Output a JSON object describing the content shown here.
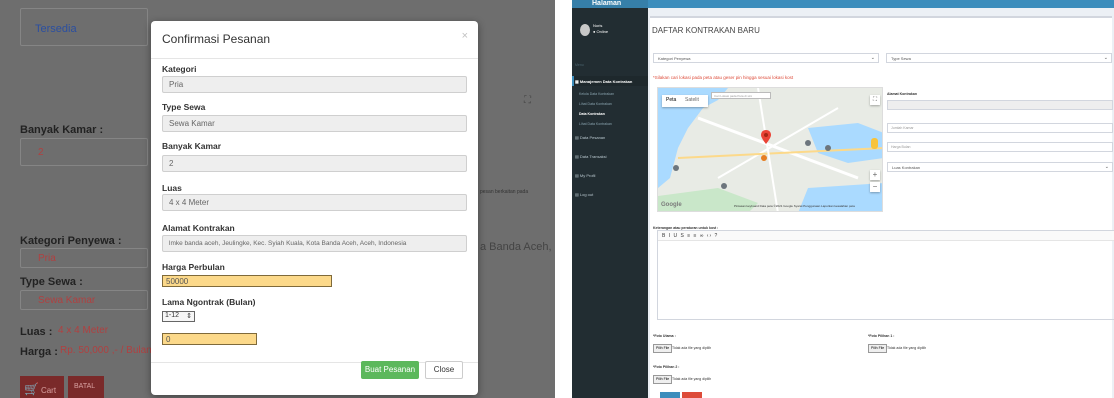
{
  "left": {
    "background": {
      "status_value": "Tersedia",
      "banyak_kamar_label": "Banyak Kamar :",
      "banyak_kamar_value": "2",
      "kategori_label": "Kategori Penyewa :",
      "kategori_value": "Pria",
      "type_sewa_label": "Type Sewa :",
      "type_sewa_value": "Sewa Kamar",
      "luas_label": "Luas :",
      "luas_value": "4 x 4 Meter",
      "harga_label": "Harga :",
      "harga_value": "Rp. 50,000 ,- / Bulan",
      "address_partial": "a Banda Aceh,",
      "side_caption": "pesan berkaitan pada",
      "cart_button": "Cart",
      "cancel_button": "BATAL",
      "expand_icon_glyph": "⛶"
    },
    "modal": {
      "title": "Confirmasi Pesanan",
      "close_glyph": "×",
      "fields": {
        "kategori": {
          "label": "Kategori",
          "value": "Pria"
        },
        "type_sewa": {
          "label": "Type Sewa",
          "value": "Sewa Kamar"
        },
        "banyak_kamar": {
          "label": "Banyak Kamar",
          "value": "2"
        },
        "luas": {
          "label": "Luas",
          "value": "4 x 4 Meter"
        },
        "alamat": {
          "label": "Alamat Kontrakan",
          "value": "lmke banda aceh, Jeulingke, Kec. Syiah Kuala, Kota Banda Aceh, Aceh, Indonesia"
        },
        "harga": {
          "label": "Harga Perbulan",
          "value": "50000"
        },
        "lama": {
          "label": "Lama Ngontrak (Bulan)",
          "value": "1-12"
        },
        "total": {
          "value": "0"
        }
      },
      "buat_button": "Buat Pesanan",
      "close_button": "Close"
    }
  },
  "right": {
    "brand": "Halaman",
    "user": {
      "name": "Noris",
      "status": "● Online"
    },
    "sidebar": {
      "header": "Menu",
      "items": [
        {
          "label": "Manajemen Data Kontrakan",
          "bold": true
        },
        {
          "label": "Kelola Data Kontrakan",
          "sub": true
        },
        {
          "label": "Lihat Data Kontrakan",
          "sub": true
        },
        {
          "label": "Data Kontrakan",
          "sub": true,
          "bold": true
        },
        {
          "label": "Lihat Data Kontrakan",
          "sub": true
        },
        {
          "label": "Data Pesanan"
        },
        {
          "label": "Data Transaksi"
        },
        {
          "label": "My Profil"
        },
        {
          "label": "Log out"
        }
      ]
    },
    "page_title": "DAFTAR KONTRAKAN BARU",
    "kategori_select": "Kategori Penyewa",
    "type_select": "Type Sewa",
    "note": "*Silakan cari lokasi pada peta atau geser pin hingga sesuai lokasi kost",
    "map": {
      "tab_map": "Peta",
      "tab_satellite": "Satelit",
      "search_placeholder": "Cari Lokasi pada Peta di sini",
      "google_logo": "Google",
      "attribution": "Pintasan keyboard   Data peta ©2021 Google   Syarat Penggunaan   Laporkan kesalahan peta",
      "full_glyph": "⛶",
      "zoom_in": "+",
      "zoom_out": "−"
    },
    "alamat_label": "Alamat Kontrakan",
    "alamat_value": "",
    "jumlah_kamar": "Jumlah Kamar",
    "harga_bulan": "Harga Bulan",
    "luas_select": "Luas Kontrakan",
    "keterangan_label": "Keterangan atau peraturan untuk kost :",
    "editor_toolbar": "B  I  U  S  ≡  ≡  ∞  ‹›  ?",
    "foto_utama": "*Foto Utama :",
    "foto_pilihan1": "*Foto Pilihan 1 :",
    "foto_pilihan2": "*Foto Pilihan 2 :",
    "pilih_file": "Pilih File",
    "no_file": "Tidak ada file yang dipilih",
    "colors": {
      "header_blue": "#3c8dbc",
      "sidebar_dark": "#222d32",
      "btn_blue": "#3c8dbc",
      "btn_red": "#dd4b39"
    }
  }
}
